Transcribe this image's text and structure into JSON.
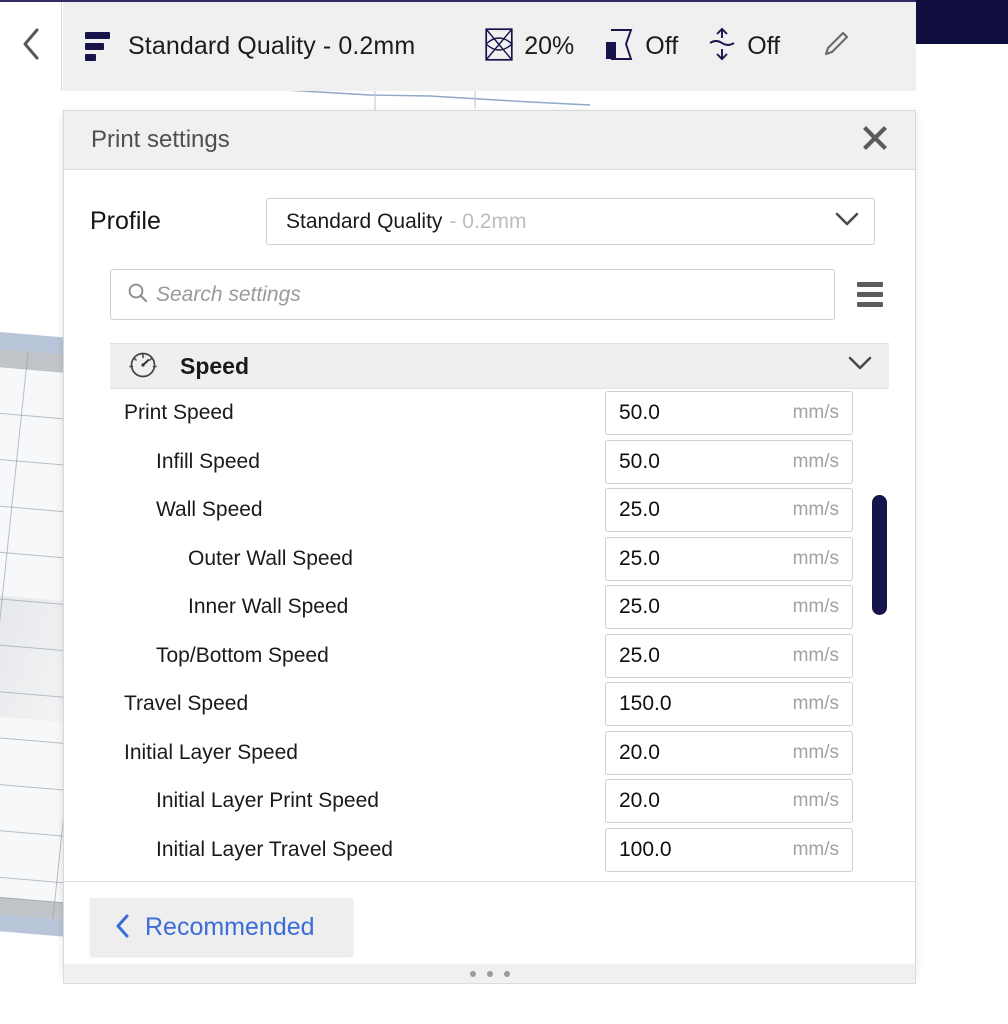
{
  "toolbar": {
    "back_icon": "chevron-left-icon",
    "layer_icon": "layer-height-icon",
    "profile_title": "Standard Quality - 0.2mm",
    "items": [
      {
        "icon": "infill-icon",
        "value": "20%"
      },
      {
        "icon": "support-icon",
        "value": "Off"
      },
      {
        "icon": "adhesion-icon",
        "value": "Off"
      }
    ],
    "edit_icon": "pencil-icon"
  },
  "panel": {
    "title": "Print settings",
    "close_icon": "close-icon",
    "profile": {
      "label": "Profile",
      "value": "Standard Quality",
      "suffix": "- 0.2mm",
      "chevron_icon": "chevron-down-icon"
    },
    "search": {
      "icon": "search-icon",
      "placeholder": "Search settings",
      "value": "",
      "menu_icon": "hamburger-menu-icon"
    },
    "section": {
      "icon": "speedometer-icon",
      "title": "Speed",
      "chevron_icon": "chevron-down-icon",
      "expanded": true
    },
    "settings": [
      {
        "label": "Print Speed",
        "level": 0,
        "value": "50.0",
        "unit": "mm/s"
      },
      {
        "label": "Infill Speed",
        "level": 1,
        "value": "50.0",
        "unit": "mm/s"
      },
      {
        "label": "Wall Speed",
        "level": 1,
        "value": "25.0",
        "unit": "mm/s"
      },
      {
        "label": "Outer Wall Speed",
        "level": 2,
        "value": "25.0",
        "unit": "mm/s"
      },
      {
        "label": "Inner Wall Speed",
        "level": 2,
        "value": "25.0",
        "unit": "mm/s"
      },
      {
        "label": "Top/Bottom Speed",
        "level": 1,
        "value": "25.0",
        "unit": "mm/s"
      },
      {
        "label": "Travel Speed",
        "level": 0,
        "value": "150.0",
        "unit": "mm/s"
      },
      {
        "label": "Initial Layer Speed",
        "level": 0,
        "value": "20.0",
        "unit": "mm/s"
      },
      {
        "label": "Initial Layer Print Speed",
        "level": 1,
        "value": "20.0",
        "unit": "mm/s"
      },
      {
        "label": "Initial Layer Travel Speed",
        "level": 1,
        "value": "100.0",
        "unit": "mm/s"
      }
    ],
    "footer": {
      "recommended_label": "Recommended",
      "recommended_icon": "chevron-left-icon"
    },
    "resize_grip_icon": "dots-grip-icon"
  },
  "colors": {
    "accent_navy": "#16144a",
    "link_blue": "#3b6cd8",
    "panel_header_bg": "#f0f0f0",
    "section_bg": "#efefef",
    "muted_text": "#a2a2a2"
  }
}
